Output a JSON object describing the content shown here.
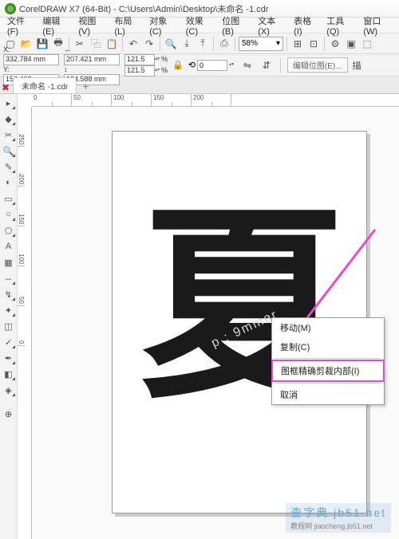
{
  "title": "CorelDRAW X7 (64-Bit) - C:\\Users\\Admin\\Desktop\\未命名 -1.cdr",
  "menu": {
    "items": [
      "文件(F)",
      "编辑(E)",
      "视图(V)",
      "布局(L)",
      "对象(C)",
      "效果(C)",
      "位图(B)",
      "文本(X)",
      "表格(I)",
      "工具(Q)",
      "窗口(W)"
    ]
  },
  "toolbar1": {
    "zoom_value": "58%"
  },
  "propbar": {
    "x_label": "X:",
    "x_val": "332.784 mm",
    "y_label": "Y:",
    "y_val": "156.402 mm",
    "w_val": "207.421 mm",
    "h_val": "184.588 mm",
    "sx_val": "121.5",
    "sy_val": "121.5",
    "pct": "%",
    "rot_val": "0",
    "editpos": "编辑位图(E)...",
    "trace": "描"
  },
  "tab": {
    "name": "未命名 -1.cdr"
  },
  "ruler_h": [
    "0",
    "50",
    "100",
    "150",
    "200"
  ],
  "ruler_v": [
    "250",
    "200",
    "150",
    "100",
    "50",
    "0"
  ],
  "canvas_char": "夏",
  "context_menu": {
    "move": "移动(M)",
    "copy": "复制(C)",
    "clip": "图框精确剪裁内部(I)",
    "cancel": "取消"
  },
  "watermark": "p : 9mmer",
  "wm2_main": "查字典  jb51.net",
  "wm2_sub": "教程网  jiaocheng.jb51.net"
}
